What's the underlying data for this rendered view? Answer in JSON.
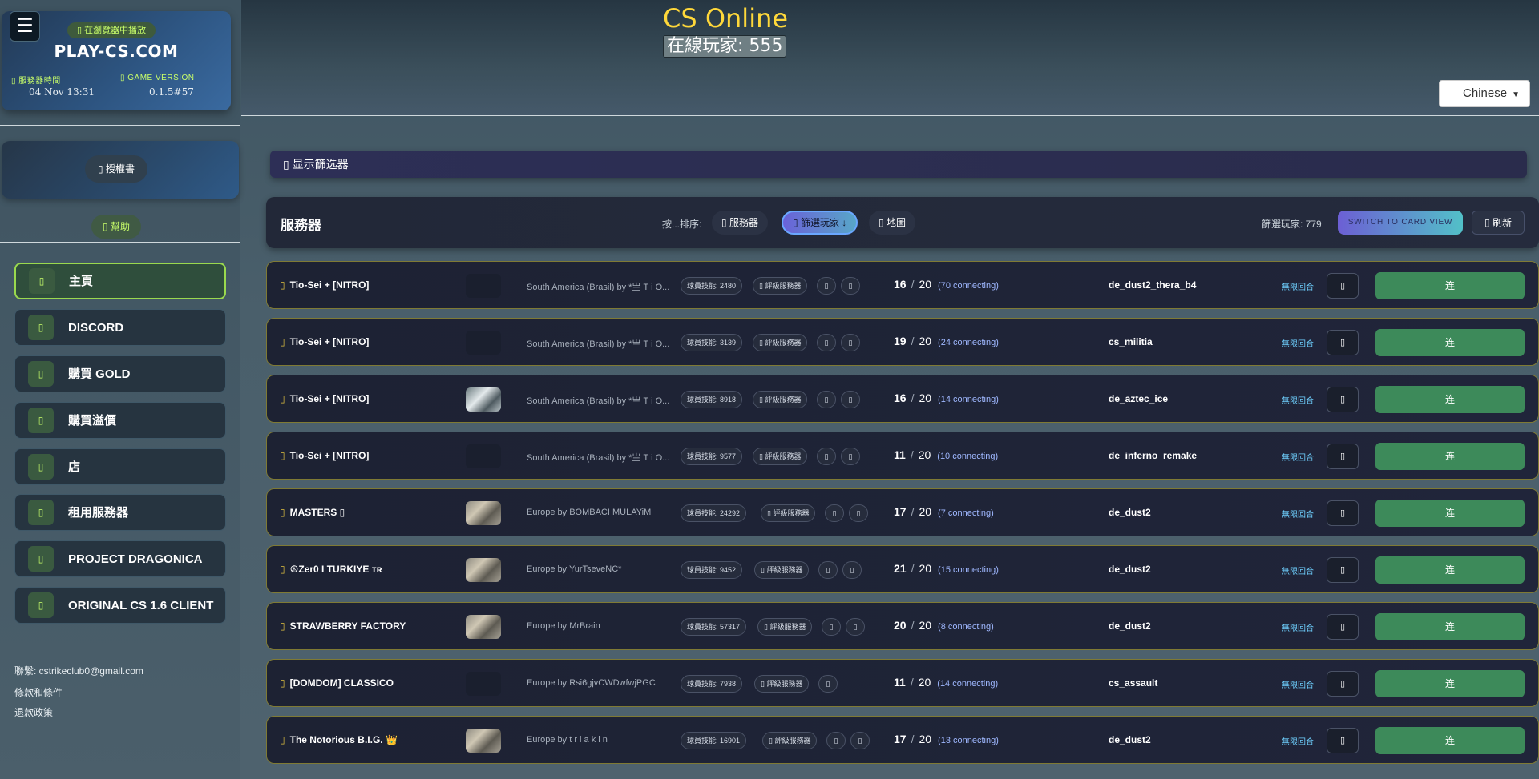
{
  "sidebar": {
    "menu_glyph": "☰",
    "play_in_browser": "▯ 在瀏覽器中播放",
    "brand": "PLAY-CS.COM",
    "server_time_label": "▯ 服務器時間",
    "server_time": "04 Nov 13:31",
    "game_version_label": "▯ GAME VERSION",
    "game_version": "0.1.5#57",
    "auth_label": "▯ 授權書",
    "help_label": "▯ 幫助",
    "nav_icon": "▯",
    "nav": [
      {
        "label": "主頁",
        "active": true
      },
      {
        "label": "DISCORD"
      },
      {
        "label": "購買 GOLD"
      },
      {
        "label": "購買溢價"
      },
      {
        "label": "店"
      },
      {
        "label": "租用服務器"
      },
      {
        "label": "PROJECT DRAGONICA"
      },
      {
        "label": "ORIGINAL CS 1.6 CLIENT"
      }
    ],
    "contact": "聯繫: cstrikeclub0@gmail.com",
    "terms": "條款和條件",
    "refund": "退款政策"
  },
  "header": {
    "title": "CS Online",
    "online": "在線玩家: 555",
    "language": "Chinese",
    "language_caret": "▼"
  },
  "filter": {
    "label": "▯ 显示篩选器"
  },
  "servers": {
    "title": "服務器",
    "sort_by": "按...排序:",
    "sort_server": "▯ 服務器",
    "sort_players": "▯ 篩選玩家 ↓",
    "sort_map": "▯ 地圖",
    "filtered": "篩選玩家: 779",
    "card_view": "SWITCH TO CARD VIEW",
    "refresh": "▯ 刷新",
    "rows": [
      {
        "name": "Tio-Sei + [NITRO]",
        "thumb": "dark",
        "region": "South America (Brasil) by *亗 T i O...",
        "skill": "球員技能: 2480",
        "rate": "▯ 評級服務器",
        "extras": [
          "▯",
          "▯"
        ],
        "players": "16",
        "max": "20",
        "connecting": "(70 connecting)",
        "map": "de_dust2_thera_b4",
        "rounds": "無限回合",
        "fav": "▯",
        "connect": "连"
      },
      {
        "name": "Tio-Sei + [NITRO]",
        "thumb": "dark",
        "region": "South America (Brasil) by *亗 T i O...",
        "skill": "球員技能: 3139",
        "rate": "▯ 評級服務器",
        "extras": [
          "▯",
          "▯"
        ],
        "players": "19",
        "max": "20",
        "connecting": "(24 connecting)",
        "map": "cs_militia",
        "rounds": "無限回合",
        "fav": "▯",
        "connect": "连"
      },
      {
        "name": "Tio-Sei + [NITRO]",
        "thumb": "ice",
        "region": "South America (Brasil) by *亗 T i O...",
        "skill": "球員技能: 8918",
        "rate": "▯ 評級服務器",
        "extras": [
          "▯",
          "▯"
        ],
        "players": "16",
        "max": "20",
        "connecting": "(14 connecting)",
        "map": "de_aztec_ice",
        "rounds": "無限回合",
        "fav": "▯",
        "connect": "连"
      },
      {
        "name": "Tio-Sei + [NITRO]",
        "thumb": "dark",
        "region": "South America (Brasil) by *亗 T i O...",
        "skill": "球員技能: 9577",
        "rate": "▯ 評級服務器",
        "extras": [
          "▯",
          "▯"
        ],
        "players": "11",
        "max": "20",
        "connecting": "(10 connecting)",
        "map": "de_inferno_remake",
        "rounds": "無限回合",
        "fav": "▯",
        "connect": "连"
      },
      {
        "name": "MASTERS ▯",
        "thumb": "img",
        "region": "Europe by BOMBACI MULAYiM",
        "skill": "球員技能: 24292",
        "rate": "▯ 評級服務器",
        "extras": [
          "▯",
          "▯"
        ],
        "players": "17",
        "max": "20",
        "connecting": "(7 connecting)",
        "map": "de_dust2",
        "rounds": "無限回合",
        "fav": "▯",
        "connect": "连"
      },
      {
        "name": "☮Zer0 I TURKIYE ᴛʀ",
        "thumb": "img",
        "region": "Europe by YurTseveNC*",
        "skill": "球員技能: 9452",
        "rate": "▯ 評級服務器",
        "extras": [
          "▯",
          "▯"
        ],
        "players": "21",
        "max": "20",
        "connecting": "(15 connecting)",
        "map": "de_dust2",
        "rounds": "無限回合",
        "fav": "▯",
        "connect": "连"
      },
      {
        "name": "STRAWBERRY FACTORY",
        "thumb": "img",
        "region": "Europe by MrBrain",
        "skill": "球員技能: 57317",
        "rate": "▯ 評級服務器",
        "extras": [
          "▯",
          "▯"
        ],
        "players": "20",
        "max": "20",
        "connecting": "(8 connecting)",
        "map": "de_dust2",
        "rounds": "無限回合",
        "fav": "▯",
        "connect": "连"
      },
      {
        "name": "[DOMDOM] CLASSICO",
        "thumb": "dark",
        "region": "Europe by Rsi6gjvCWDwfwjPGC",
        "skill": "球員技能: 7938",
        "rate": "▯ 評級服務器",
        "extras": [
          "▯"
        ],
        "players": "11",
        "max": "20",
        "connecting": "(14 connecting)",
        "map": "cs_assault",
        "rounds": "無限回合",
        "fav": "▯",
        "connect": "连"
      },
      {
        "name": "The Notorious B.I.G. 👑",
        "thumb": "img",
        "region": "Europe by t r i a k i n",
        "skill": "球員技能: 16901",
        "rate": "▯ 評級服務器",
        "extras": [
          "▯",
          "▯"
        ],
        "players": "17",
        "max": "20",
        "connecting": "(13 connecting)",
        "map": "de_dust2",
        "rounds": "無限回合",
        "fav": "▯",
        "connect": "连"
      }
    ]
  }
}
